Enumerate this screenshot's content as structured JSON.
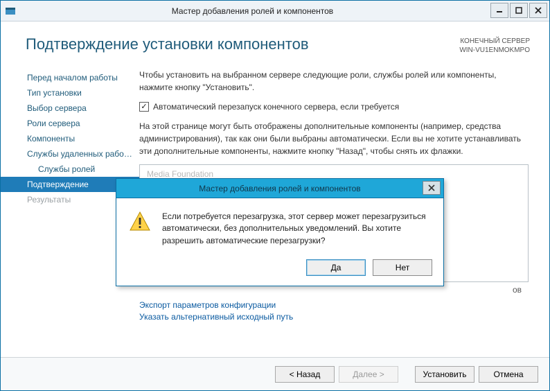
{
  "window": {
    "title": "Мастер добавления ролей и компонентов"
  },
  "header": {
    "page_title": "Подтверждение установки компонентов",
    "dest_label": "КОНЕЧНЫЙ СЕРВЕР",
    "dest_value": "WIN-VU1ENMOKMPO"
  },
  "sidebar": {
    "items": [
      {
        "label": "Перед началом работы"
      },
      {
        "label": "Тип установки"
      },
      {
        "label": "Выбор сервера"
      },
      {
        "label": "Роли сервера"
      },
      {
        "label": "Компоненты"
      },
      {
        "label": "Службы удаленных рабо…"
      },
      {
        "label": "Службы ролей"
      },
      {
        "label": "Подтверждение"
      },
      {
        "label": "Результаты"
      }
    ]
  },
  "main": {
    "intro": "Чтобы установить на выбранном сервере следующие роли, службы ролей или компоненты, нажмите кнопку \"Установить\".",
    "checkbox_label": "Автоматический перезапуск конечного сервера, если требуется",
    "checkbox_checked": true,
    "note": "На этой странице могут быть отображены дополнительные компоненты (например, средства администрирования), так как они были выбраны автоматически. Если вы не хотите устанавливать эти дополнительные компоненты, нажмите кнопку \"Назад\", чтобы снять их флажки.",
    "list_first_item": "Media Foundation",
    "list_trailing": "ов",
    "link_export": "Экспорт параметров конфигурации",
    "link_altpath": "Указать альтернативный исходный путь"
  },
  "footer": {
    "back": "< Назад",
    "next": "Далее >",
    "install": "Установить",
    "cancel": "Отмена"
  },
  "dialog": {
    "title": "Мастер добавления ролей и компонентов",
    "message": "Если потребуется перезагрузка, этот сервер может перезагрузиться автоматически, без дополнительных уведомлений. Вы хотите разрешить автоматические перезагрузки?",
    "yes": "Да",
    "no": "Нет"
  }
}
